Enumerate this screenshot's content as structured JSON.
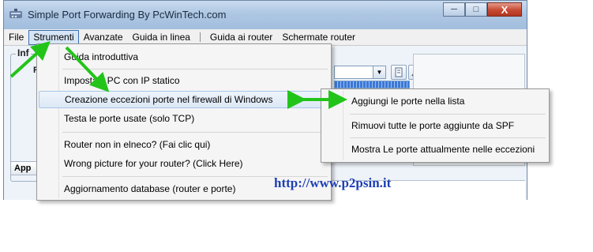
{
  "window": {
    "title": "Simple Port Forwarding By PcWinTech.com",
    "minimize_label": "─",
    "maximize_label": "□",
    "close_label": "X"
  },
  "menubar": {
    "items": [
      {
        "label": "File"
      },
      {
        "label": "Strumenti"
      },
      {
        "label": "Avanzate"
      },
      {
        "label": "Guida in linea"
      },
      {
        "label": "Guida ai router"
      },
      {
        "label": "Schermate router"
      }
    ],
    "active_index": 1
  },
  "background_panel": {
    "group_title": "Inf",
    "group_sub": "R",
    "list_header": "App"
  },
  "strumenti_menu": {
    "items": [
      {
        "label": "Guida introduttiva"
      },
      {
        "label": "Imposta il PC con IP statico"
      },
      {
        "label": "Creazione eccezioni porte nel firewall di Windows",
        "has_submenu": true
      },
      {
        "label": "Testa le porte usate (solo TCP)"
      },
      {
        "label": "Router non in elneco? (Fai clic qui)"
      },
      {
        "label": "Wrong picture for your router? (Click Here)"
      },
      {
        "label": "Aggiornamento database (router e porte)"
      }
    ],
    "highlighted_index": 2
  },
  "firewall_submenu": {
    "items": [
      {
        "label": "Aggiungi le porte nella lista"
      },
      {
        "label": "Rimuovi tutte le porte aggiunte da SPF"
      },
      {
        "label": "Mostra Le porte attualmente nelle eccezioni"
      }
    ]
  },
  "watermark": {
    "url": "http://www.p2psin.it"
  },
  "colors": {
    "annotation_arrow": "#22c41a",
    "watermark_text": "#1d3fb4",
    "menu_highlight": "#dce8f6"
  },
  "icons": {
    "app_icon": "spf-app-icon",
    "combo_arrow": "chevron-down-icon",
    "tool_button_1": "document-icon",
    "tool_button_2": "tools-icon",
    "submenu_arrow": "chevron-right-icon"
  }
}
